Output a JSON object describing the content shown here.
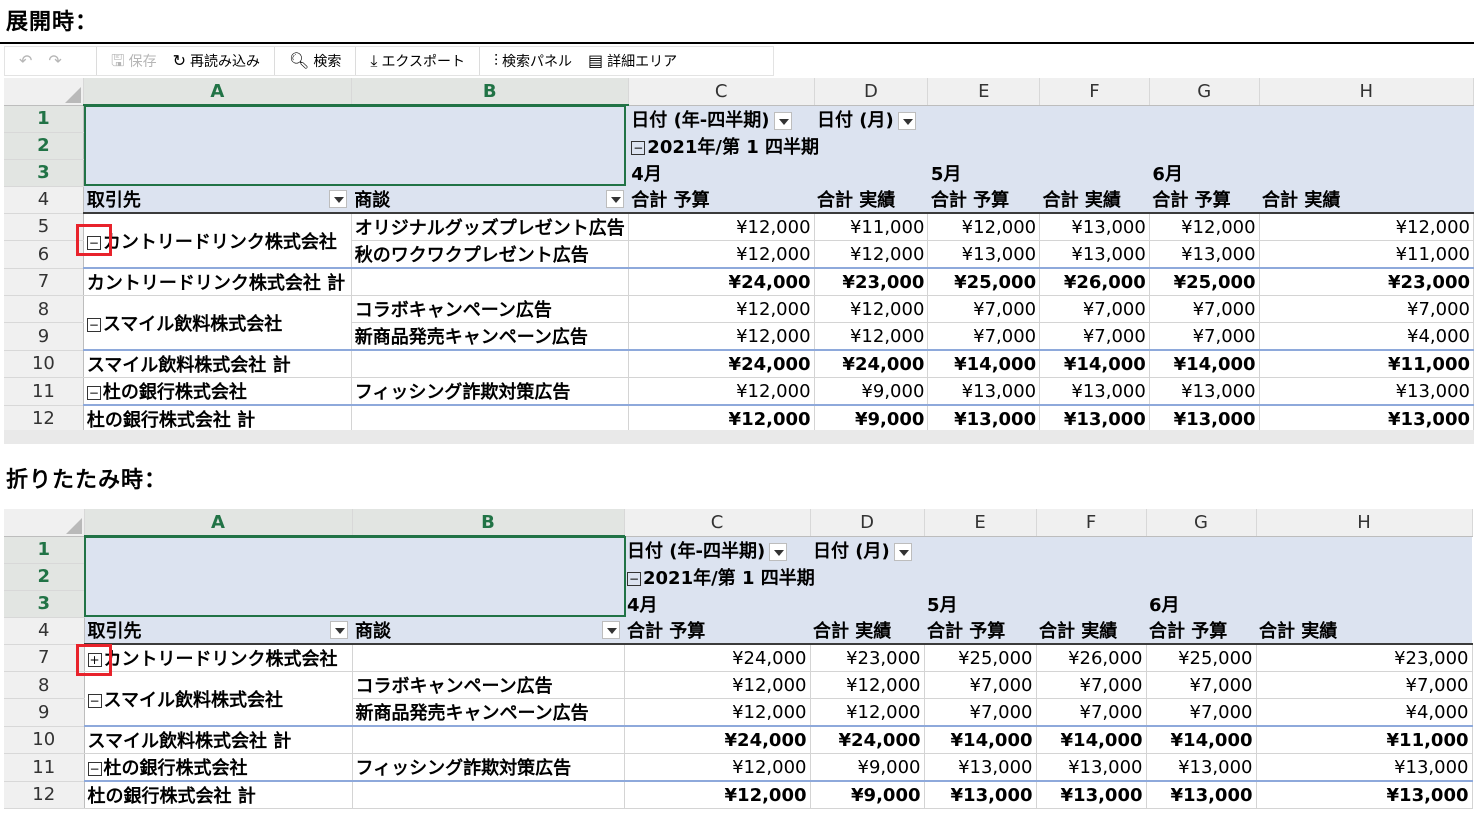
{
  "titles": {
    "expanded": "展開時：",
    "collapsed": "折りたたみ時："
  },
  "toolbar": {
    "undo_icon": "undo-icon",
    "redo_icon": "redo-icon",
    "save": "保存",
    "reload": "再読み込み",
    "search": "検索",
    "export": "エクスポート",
    "search_panel": "検索パネル",
    "detail_area": "詳細エリア"
  },
  "columns": [
    "A",
    "B",
    "C",
    "D",
    "E",
    "F",
    "G",
    "H"
  ],
  "header_rows": {
    "date_quarter": "日付 (年-四半期)",
    "date_month": "日付 (月)",
    "quarter": "2021年/第 1 四半期",
    "months": [
      "4月",
      "5月",
      "6月"
    ],
    "client": "取引先",
    "deal": "商談",
    "measures": [
      "合計 予算",
      "合計 実績",
      "合計 予算",
      "合計 実績",
      "合計 予算",
      "合計 実績"
    ]
  },
  "expanded_rows": [
    {
      "row": "5",
      "a": "カントリードリンク株式会社",
      "b": "オリジナルグッズプレゼント広告",
      "vals": [
        "¥12,000",
        "¥11,000",
        "¥12,000",
        "¥13,000",
        "¥12,000",
        "¥12,000"
      ],
      "total": false
    },
    {
      "row": "6",
      "a": "",
      "b": "秋のワクワクプレゼント広告",
      "vals": [
        "¥12,000",
        "¥12,000",
        "¥13,000",
        "¥13,000",
        "¥13,000",
        "¥11,000"
      ],
      "total": false
    },
    {
      "row": "7",
      "a": "カントリードリンク株式会社 計",
      "b": "",
      "vals": [
        "¥24,000",
        "¥23,000",
        "¥25,000",
        "¥26,000",
        "¥25,000",
        "¥23,000"
      ],
      "total": true
    },
    {
      "row": "8",
      "a": "スマイル飲料株式会社",
      "b": "コラボキャンペーン広告",
      "vals": [
        "¥12,000",
        "¥12,000",
        "¥7,000",
        "¥7,000",
        "¥7,000",
        "¥7,000"
      ],
      "total": false
    },
    {
      "row": "9",
      "a": "",
      "b": "新商品発売キャンペーン広告",
      "vals": [
        "¥12,000",
        "¥12,000",
        "¥7,000",
        "¥7,000",
        "¥7,000",
        "¥4,000"
      ],
      "total": false
    },
    {
      "row": "10",
      "a": "スマイル飲料株式会社 計",
      "b": "",
      "vals": [
        "¥24,000",
        "¥24,000",
        "¥14,000",
        "¥14,000",
        "¥14,000",
        "¥11,000"
      ],
      "total": true
    },
    {
      "row": "11",
      "a": "杜の銀行株式会社",
      "b": "フィッシング詐欺対策広告",
      "vals": [
        "¥12,000",
        "¥9,000",
        "¥13,000",
        "¥13,000",
        "¥13,000",
        "¥13,000"
      ],
      "total": false
    },
    {
      "row": "12",
      "a": "杜の銀行株式会社 計",
      "b": "",
      "vals": [
        "¥12,000",
        "¥9,000",
        "¥13,000",
        "¥13,000",
        "¥13,000",
        "¥13,000"
      ],
      "total": true
    }
  ],
  "collapsed_rows": [
    {
      "row": "7",
      "a": "カントリードリンク株式会社",
      "b": "",
      "vals": [
        "¥24,000",
        "¥23,000",
        "¥25,000",
        "¥26,000",
        "¥25,000",
        "¥23,000"
      ],
      "total": false
    },
    {
      "row": "8",
      "a": "スマイル飲料株式会社",
      "b": "コラボキャンペーン広告",
      "vals": [
        "¥12,000",
        "¥12,000",
        "¥7,000",
        "¥7,000",
        "¥7,000",
        "¥7,000"
      ],
      "total": false
    },
    {
      "row": "9",
      "a": "",
      "b": "新商品発売キャンペーン広告",
      "vals": [
        "¥12,000",
        "¥12,000",
        "¥7,000",
        "¥7,000",
        "¥7,000",
        "¥4,000"
      ],
      "total": false
    },
    {
      "row": "10",
      "a": "スマイル飲料株式会社 計",
      "b": "",
      "vals": [
        "¥24,000",
        "¥24,000",
        "¥14,000",
        "¥14,000",
        "¥14,000",
        "¥11,000"
      ],
      "total": true
    },
    {
      "row": "11",
      "a": "杜の銀行株式会社",
      "b": "フィッシング詐欺対策広告",
      "vals": [
        "¥12,000",
        "¥9,000",
        "¥13,000",
        "¥13,000",
        "¥13,000",
        "¥13,000"
      ],
      "total": false
    },
    {
      "row": "12",
      "a": "杜の銀行株式会社 計",
      "b": "",
      "vals": [
        "¥12,000",
        "¥9,000",
        "¥13,000",
        "¥13,000",
        "¥13,000",
        "¥13,000"
      ],
      "total": true
    }
  ],
  "row_numbers": [
    "1",
    "2",
    "3",
    "4"
  ],
  "colors": {
    "selection": "#217346",
    "highlight": "#e8222b",
    "pivot_header": "#dce3f0"
  }
}
